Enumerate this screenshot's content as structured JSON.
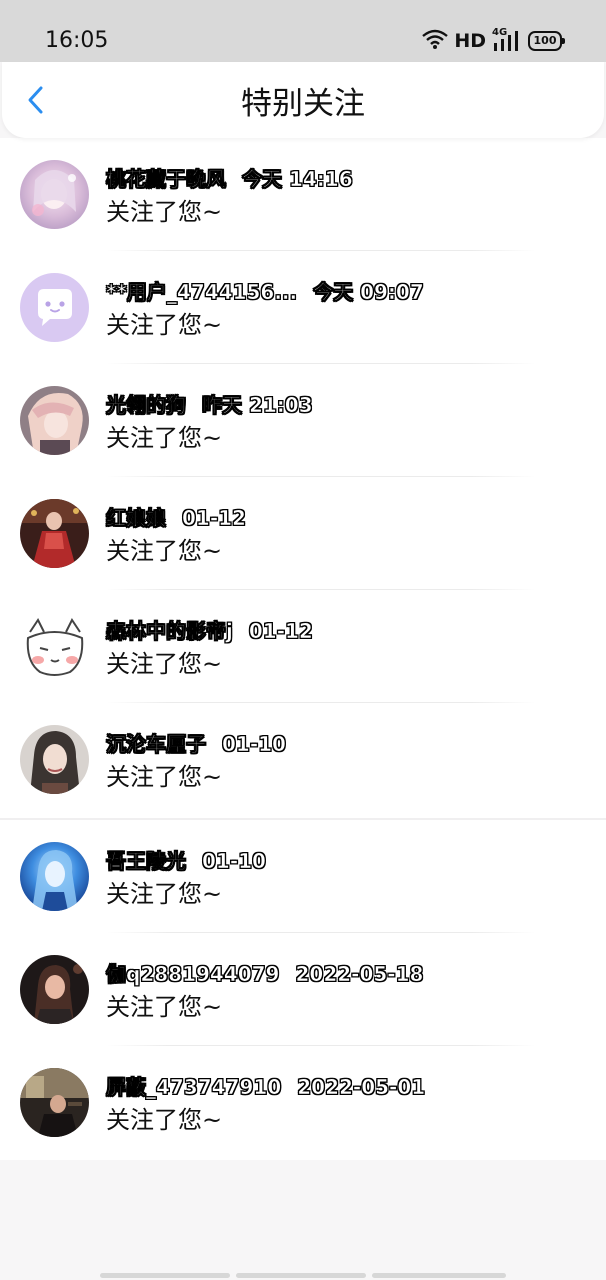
{
  "status_bar": {
    "time": "16:05",
    "network_type": "4G",
    "hd_label": "HD",
    "battery": "100"
  },
  "header": {
    "title": "特别关注",
    "back_icon": "chevron-left-icon",
    "accent_color": "#2b8ef0"
  },
  "list": {
    "items": [
      {
        "name": "桃花藏于晚风",
        "time": "今天 14:16",
        "message": "关注了您~"
      },
      {
        "name": "**用户_4744156...",
        "time": "今天 09:07",
        "message": "关注了您~"
      },
      {
        "name": "光翎的狗",
        "time": "昨天 21:03",
        "message": "关注了您~"
      },
      {
        "name": "红娘娘",
        "time": "01-12",
        "message": "关注了您~"
      },
      {
        "name": "森林中的影帝j",
        "time": "01-12",
        "message": "关注了您~"
      },
      {
        "name": "沉沦车厘子",
        "time": "01-10",
        "message": "关注了您~"
      },
      {
        "name": "吾王陵光",
        "time": "01-10",
        "message": "关注了您~"
      },
      {
        "name": "伽q2881944079",
        "time": "2022-05-18",
        "message": "关注了您~"
      },
      {
        "name": "屏蔽_473747910",
        "time": "2022-05-01",
        "message": "关注了您~"
      }
    ]
  }
}
